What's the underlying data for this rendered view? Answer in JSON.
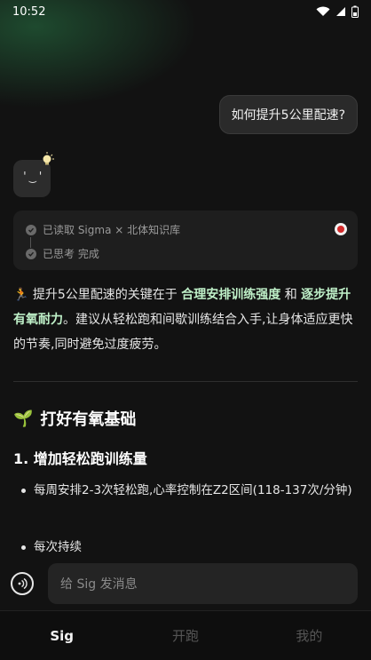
{
  "status_bar": {
    "time": "10:52"
  },
  "chat": {
    "user_message": "如何提升5公里配速?",
    "assistant_status": {
      "read_line": "已读取 Sigma × 北体知识库",
      "think_line": "已思考 完成"
    },
    "answer": {
      "emoji": "🏃",
      "intro_1": " 提升5公里配速的关键在于 ",
      "highlight_1": "合理安排训练强度",
      "intro_2": " 和 ",
      "highlight_2": "逐步提升有氧耐力",
      "intro_3": "。建议从轻松跑和间歇训练结合入手,让身体适应更快的节奏,同时避免过度疲劳。"
    },
    "section_title_emoji": "🌱",
    "section_title": "打好有氧基础",
    "subsection_title": "1. 增加轻松跑训练量",
    "bullets": [
      "每周安排2-3次轻松跑,心率控制在Z2区间(118-137次/分钟)",
      "每次持续"
    ]
  },
  "input": {
    "placeholder": "给 Sig 发消息"
  },
  "tabs": [
    {
      "label": "Sig",
      "active": true
    },
    {
      "label": "开跑",
      "active": false
    },
    {
      "label": "我的",
      "active": false
    }
  ],
  "colors": {
    "highlight": "#bff0c8",
    "background": "#121212"
  }
}
